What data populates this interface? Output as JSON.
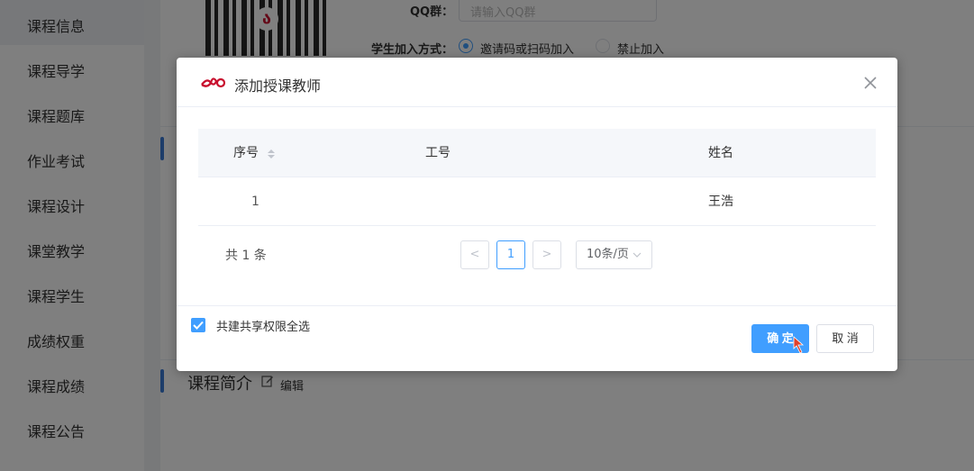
{
  "sidebar": {
    "items": [
      {
        "label": "课程信息"
      },
      {
        "label": "课程导学"
      },
      {
        "label": "课程题库"
      },
      {
        "label": "作业考试"
      },
      {
        "label": "课程设计"
      },
      {
        "label": "课堂教学"
      },
      {
        "label": "课程学生"
      },
      {
        "label": "成绩权重"
      },
      {
        "label": "课程成绩"
      },
      {
        "label": "课程公告"
      }
    ]
  },
  "course_form": {
    "qq_label": "QQ群：",
    "qq_placeholder": "请输入QQ群",
    "join_label": "学生加入方式：",
    "join_options": [
      "邀请码或扫码加入",
      "禁止加入"
    ],
    "join_selected": "邀请码或扫码加入"
  },
  "intro": {
    "title": "课程简介",
    "edit_label": "编辑"
  },
  "dialog": {
    "title": "添加授课教师",
    "table": {
      "headers": [
        "序号",
        "工号",
        "姓名"
      ],
      "rows": [
        {
          "index": "1",
          "staff_id": "",
          "name": "王浩"
        }
      ]
    },
    "pagination": {
      "total_text": "共 1 条",
      "prev": "<",
      "current_page": "1",
      "next": ">",
      "page_size": "10条/页"
    },
    "checkbox_label": "共建共享权限全选",
    "checkbox_checked": true,
    "ok_label": "确 定",
    "cancel_label": "取 消"
  },
  "colors": {
    "primary": "#409eff",
    "brand_red": "#c8102e"
  }
}
